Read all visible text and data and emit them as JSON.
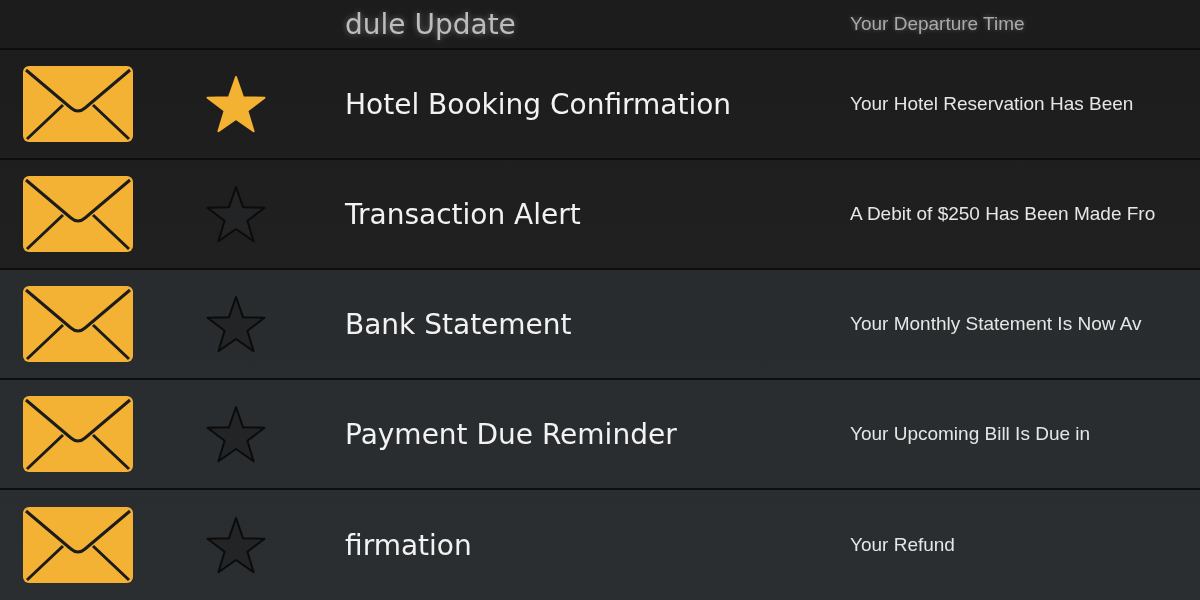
{
  "rows": [
    {
      "kind": "edge",
      "subject": "dule Update",
      "preview": "Your Departure Time"
    },
    {
      "kind": "full",
      "starred": true,
      "subject": "Hotel Booking Confirmation",
      "preview": "Your Hotel Reservation Has Been"
    },
    {
      "kind": "full",
      "starred": false,
      "subject": "Transaction Alert",
      "preview": "A Debit of $250 Has Been Made Fro"
    },
    {
      "kind": "full",
      "starred": false,
      "subject": "Bank Statement",
      "preview": "Your Monthly Statement Is Now Av"
    },
    {
      "kind": "full",
      "starred": false,
      "subject": "Payment Due Reminder",
      "preview": "Your Upcoming Bill Is Due in"
    },
    {
      "kind": "full",
      "starred": false,
      "subject": "firmation",
      "preview": "Your Refund"
    }
  ]
}
